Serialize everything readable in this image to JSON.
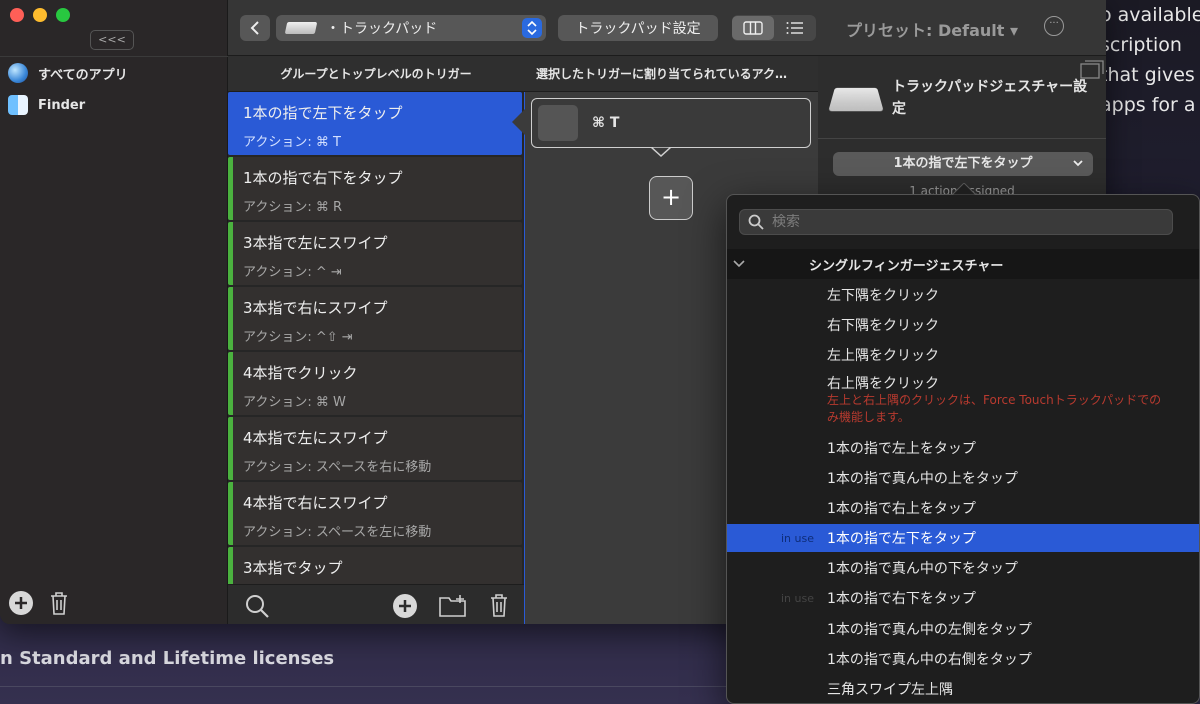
{
  "background": {
    "right_lines": [
      "o available",
      "scription",
      "that gives",
      "apps for a"
    ],
    "bottom_text": "n Standard and Lifetime licenses"
  },
  "sidebar": {
    "collapse_label": "<<<",
    "items": [
      {
        "label": "すべてのアプリ",
        "icon": "globe-icon"
      },
      {
        "label": "Finder",
        "icon": "finder-icon"
      }
    ]
  },
  "toolbar": {
    "device_label": "・トラックパッド",
    "settings_label": "トラックパッド設定",
    "preset_label": "プリセット: Default ▾"
  },
  "columns": {
    "triggers_header": "グループとトップレベルのトリガー",
    "actions_header": "選択したトリガーに割り当てられているアク…"
  },
  "triggers": [
    {
      "title": "1本の指で左下をタップ",
      "action": "アクション: ⌘ T"
    },
    {
      "title": "1本の指で右下をタップ",
      "action": "アクション: ⌘ R"
    },
    {
      "title": "3本指で左にスワイプ",
      "action": "アクション: ^ ⇥"
    },
    {
      "title": "3本指で右にスワイプ",
      "action": "アクション: ^⇧ ⇥"
    },
    {
      "title": "4本指でクリック",
      "action": "アクション: ⌘ W"
    },
    {
      "title": "4本指で左にスワイプ",
      "action": "アクション: スペースを右に移動"
    },
    {
      "title": "4本指で右にスワイプ",
      "action": "アクション: スペースを左に移動"
    },
    {
      "title": "3本指でタップ",
      "action": ""
    }
  ],
  "selected_action": {
    "label": "⌘ T"
  },
  "inspector": {
    "title": "トラックパッドジェスチャー設定",
    "selected_trigger": "1本の指で左下をタップ",
    "assigned_text": "1 action assigned"
  },
  "dropdown": {
    "search_placeholder": "検索",
    "group": "シングルフィンガージェスチャー",
    "note": "左上と右上隅のクリックは、Force Touchトラックパッドでのみ機能します。",
    "in_use_label": "in use",
    "items": [
      "左下隅をクリック",
      "右下隅をクリック",
      "左上隅をクリック",
      "右上隅をクリック",
      "1本の指で左上をタップ",
      "1本の指で真ん中の上をタップ",
      "1本の指で右上をタップ",
      "1本の指で左下をタップ",
      "1本の指で真ん中の下をタップ",
      "1本の指で右下をタップ",
      "1本の指で真ん中の左側をタップ",
      "1本の指で真ん中の右側をタップ",
      "三角スワイプ左上隅"
    ]
  },
  "colors": {
    "accent": "#2a5ad6",
    "trigger_bar": "#4bb23f",
    "warning": "#b83a2f"
  }
}
